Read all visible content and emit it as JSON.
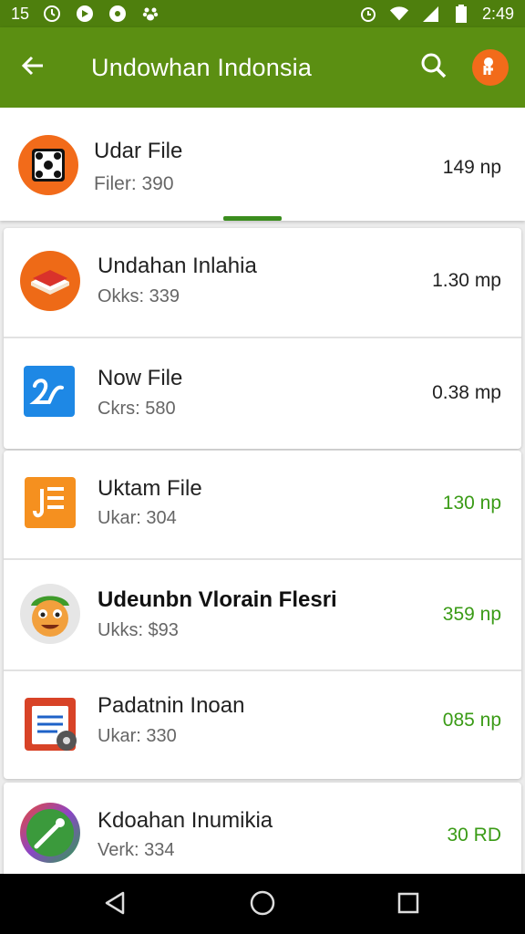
{
  "status_bar": {
    "left_text": "15",
    "time": "2:49",
    "left_icons": [
      "clock-icon",
      "message-icon",
      "media-icon",
      "paw-icon"
    ],
    "right_icons": [
      "alarm-icon",
      "wifi-icon",
      "signal-icon",
      "battery-icon"
    ]
  },
  "toolbar": {
    "title": "Undowhan Indonsia",
    "back_icon": "arrow-left-icon",
    "search_icon": "search-icon",
    "account_icon": "account-badge-icon"
  },
  "header": {
    "title": "Udar File",
    "subtitle": "Filer: 390",
    "size": "149 np",
    "icon": "dice-icon"
  },
  "colors": {
    "status_bar": "#4e7f0d",
    "toolbar": "#5b8f12",
    "accent_green": "#3a9b16",
    "orange": "#f26b1a"
  },
  "items": [
    {
      "title": "Undahan Inlahia",
      "subtitle": "Okks: 339",
      "size": "1.30 mp",
      "icon": "book-icon"
    },
    {
      "title": "Now File",
      "subtitle": "Ckrs: 580",
      "size": "0.38 mp",
      "icon": "signature-icon"
    },
    {
      "title": "Uktam File",
      "subtitle": "Ukar: 304",
      "size": "130 np",
      "icon": "document-icon"
    },
    {
      "title": "Udeunbn Vlorain Flesri",
      "subtitle": "Ukks: $93",
      "size": "359 np",
      "icon": "cartoon-face-icon"
    },
    {
      "title": "Padatnin Inoan",
      "subtitle": "Ukar: 330",
      "size": "085 np",
      "icon": "calendar-icon"
    },
    {
      "title": "Kdoahan Inumikia",
      "subtitle": "Verk: 334",
      "size": "30 RD",
      "icon": "pen-icon"
    }
  ],
  "nav": {
    "back_icon": "nav-back-icon",
    "home_icon": "nav-home-icon",
    "recents_icon": "nav-recents-icon"
  }
}
